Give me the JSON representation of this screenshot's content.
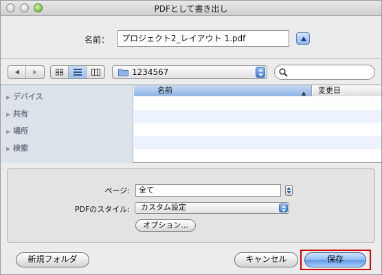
{
  "window": {
    "title": "PDFとして書き出し"
  },
  "filename": {
    "label": "名前：",
    "value": "プロジェクト2_レイアウト 1.pdf"
  },
  "toolbar": {
    "location": "1234567",
    "search_placeholder": ""
  },
  "sidebar": {
    "items": [
      {
        "label": "デバイス"
      },
      {
        "label": "共有"
      },
      {
        "label": "場所"
      },
      {
        "label": "検索"
      }
    ]
  },
  "file_list": {
    "columns": [
      {
        "label": "名前"
      },
      {
        "label": "変更日"
      }
    ],
    "rows": []
  },
  "options": {
    "pages_label": "ページ:",
    "pages_value": "全て",
    "style_label": "PDFのスタイル:",
    "style_value": "カスタム設定",
    "options_button": "オプション..."
  },
  "buttons": {
    "new_folder": "新規フォルダ",
    "cancel": "キャンセル",
    "save": "保存"
  },
  "colors": {
    "accent": "#6aa6ef",
    "highlight_frame": "#d40000"
  }
}
